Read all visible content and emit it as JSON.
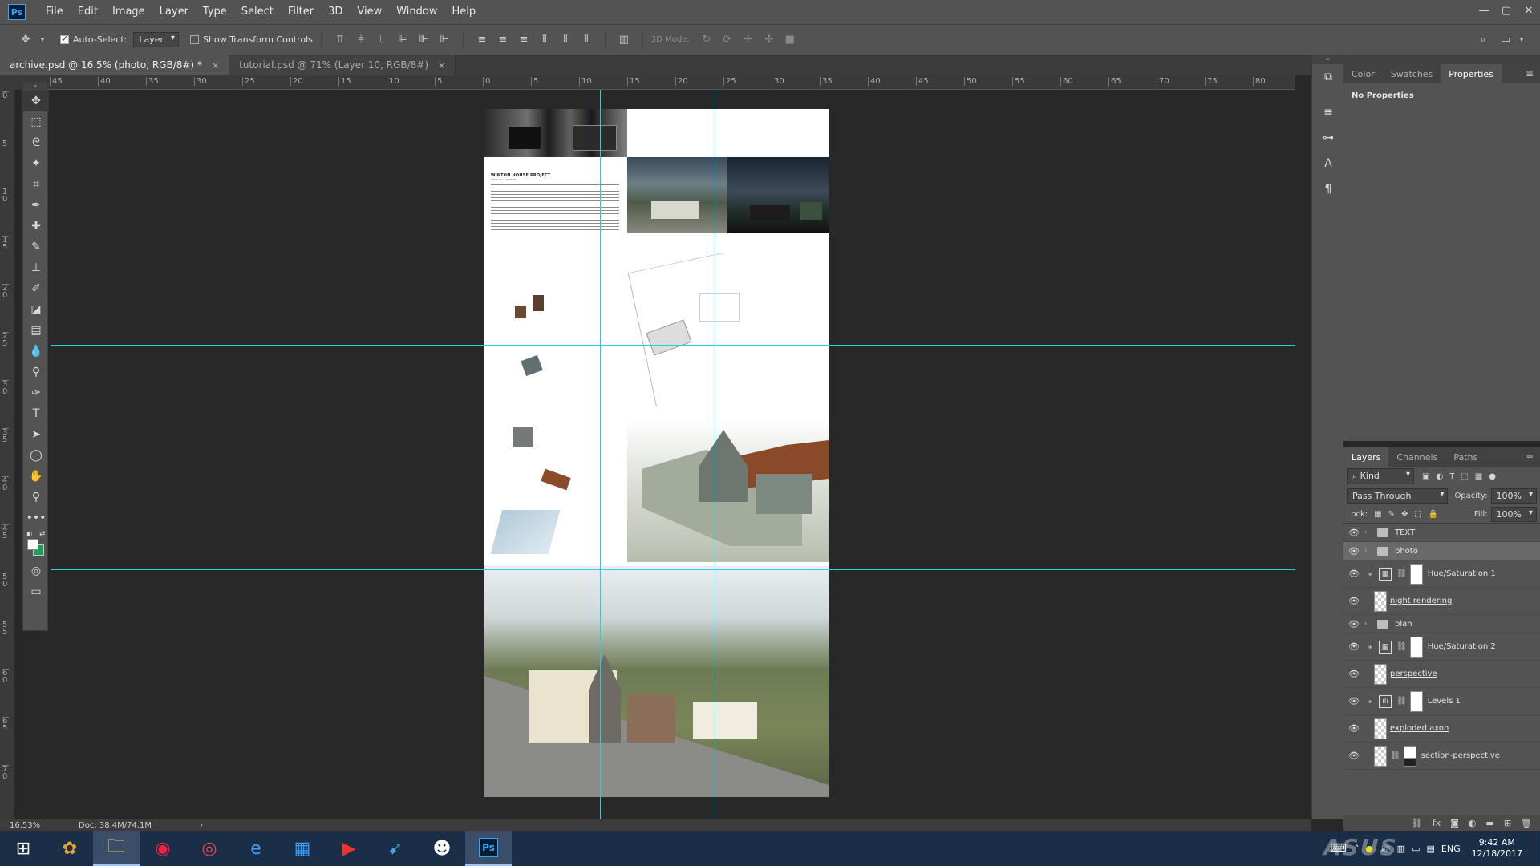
{
  "app": {
    "logo": "Ps"
  },
  "menu": [
    "File",
    "Edit",
    "Image",
    "Layer",
    "Type",
    "Select",
    "Filter",
    "3D",
    "View",
    "Window",
    "Help"
  ],
  "window_controls": [
    "—",
    "▢",
    "✕"
  ],
  "options": {
    "auto_select_label": "Auto-Select:",
    "auto_select_value": "Layer",
    "show_transform_label": "Show Transform Controls",
    "mode_3d_label": "3D Mode:"
  },
  "tabs": [
    {
      "label": "archive.psd @ 16.5% (photo, RGB/8#) *",
      "close": "×"
    },
    {
      "label": "tutorial.psd @ 71% (Layer 10, RGB/8#)",
      "close": "×"
    }
  ],
  "ruler_top_labels": [
    "45",
    "40",
    "35",
    "30",
    "25",
    "20",
    "15",
    "10",
    "5",
    "0",
    "5",
    "10",
    "15",
    "20",
    "25",
    "30",
    "35",
    "40",
    "45",
    "50",
    "55",
    "60",
    "65",
    "70",
    "75",
    "80"
  ],
  "ruler_left_labels": [
    "0",
    "5",
    "1 0",
    "1 5",
    "2 0",
    "2 5",
    "3 0",
    "3 5",
    "4 0",
    "4 5",
    "5 0",
    "5 5",
    "6 0",
    "6 5",
    "7 0"
  ],
  "artboard": {
    "heading": "WINTON HOUSE PROJECT",
    "subheading": "ARCH 101 · ARCHIVE"
  },
  "properties_panel": {
    "tabs": [
      "Color",
      "Swatches",
      "Properties"
    ],
    "active_tab": "Properties",
    "message": "No Properties"
  },
  "layers_panel": {
    "tabs": [
      "Layers",
      "Channels",
      "Paths"
    ],
    "active_tab": "Layers",
    "filter": "Kind",
    "blend_mode": "Pass Through",
    "opacity_label": "Opacity:",
    "opacity_value": "100%",
    "lock_label": "Lock:",
    "fill_label": "Fill:",
    "fill_value": "100%",
    "layers": [
      {
        "name": "TEXT",
        "kind": "group"
      },
      {
        "name": "photo",
        "kind": "group",
        "selected": true
      },
      {
        "name": "Hue/Saturation 1",
        "kind": "adjustment"
      },
      {
        "name": "night rendering",
        "kind": "pixel"
      },
      {
        "name": "plan",
        "kind": "group"
      },
      {
        "name": "Hue/Saturation 2",
        "kind": "adjustment"
      },
      {
        "name": "perspective",
        "kind": "pixel"
      },
      {
        "name": "Levels 1",
        "kind": "adjustment"
      },
      {
        "name": "exploded axon",
        "kind": "pixel"
      },
      {
        "name": "section-perspective",
        "kind": "pixel-mask"
      }
    ]
  },
  "status": {
    "zoom": "16.53%",
    "doc": "Doc: 38.4M/74.1M"
  },
  "taskbar": {
    "language": "ENG",
    "time": "9:42 AM",
    "date": "12/18/2017",
    "watermark": "ASUS"
  }
}
